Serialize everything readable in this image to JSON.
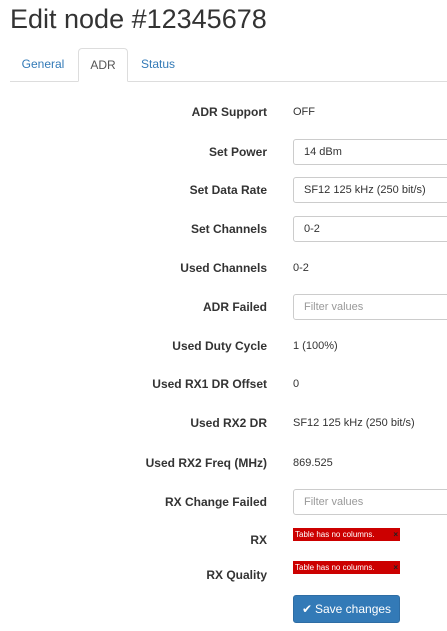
{
  "page": {
    "title": "Edit node #12345678"
  },
  "tabs": [
    {
      "label": "General"
    },
    {
      "label": "ADR"
    },
    {
      "label": "Status"
    }
  ],
  "rows": {
    "adr_support": {
      "label": "ADR Support",
      "value": "OFF"
    },
    "set_power": {
      "label": "Set Power",
      "value": "14 dBm"
    },
    "set_data_rate": {
      "label": "Set Data Rate",
      "value": "SF12 125 kHz (250 bit/s)"
    },
    "set_channels": {
      "label": "Set Channels",
      "value": "0-2"
    },
    "used_channels": {
      "label": "Used Channels",
      "value": "0-2"
    },
    "adr_failed": {
      "label": "ADR Failed",
      "placeholder": "Filter values"
    },
    "used_duty_cycle": {
      "label": "Used Duty Cycle",
      "value": "1 (100%)"
    },
    "used_rx1_dr_offset": {
      "label": "Used RX1 DR Offset",
      "value": "0"
    },
    "used_rx2_dr": {
      "label": "Used RX2 DR",
      "value": "SF12 125 kHz (250 bit/s)"
    },
    "used_rx2_freq": {
      "label": "Used RX2 Freq (MHz)",
      "value": "869.525"
    },
    "rx_change_failed": {
      "label": "RX Change Failed",
      "placeholder": "Filter values"
    },
    "rx": {
      "label": "RX",
      "error": "Table has no columns.",
      "close": "×"
    },
    "rx_quality": {
      "label": "RX Quality",
      "error": "Table has no columns.",
      "close": "×"
    }
  },
  "save_button": {
    "label": "Save changes",
    "icon": "check-icon"
  }
}
